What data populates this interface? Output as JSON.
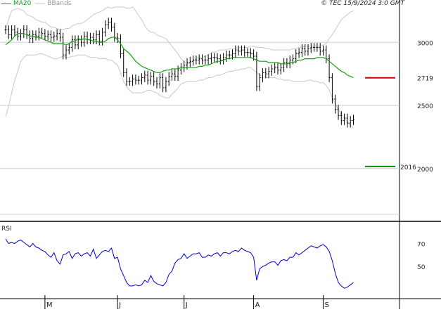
{
  "header": {
    "ma_label": "MA20",
    "bb_label": "BBands",
    "stamp": "© TEC 15/9/2024 3:0 GMT"
  },
  "colors": {
    "ma": "#10a010",
    "bands": "#c8c8c8",
    "price": "#000000",
    "rsi": "#0000c8",
    "resistance": "#cc0000",
    "support": "#009000",
    "grid": "#cccccc"
  },
  "chart_data": [
    {
      "type": "line",
      "name": "price",
      "ylim": [
        1620,
        3280
      ],
      "yticks": [
        2000,
        2500,
        3000
      ],
      "ytick_labels": [
        "2000",
        "2500",
        "3000"
      ],
      "x_month_ticks": [
        {
          "label": "M",
          "index": 13
        },
        {
          "label": "J",
          "index": 37
        },
        {
          "label": "J",
          "index": 59
        },
        {
          "label": "A",
          "index": 82
        },
        {
          "label": "S",
          "index": 105
        }
      ],
      "n": 116,
      "close": [
        3100,
        3060,
        3100,
        3080,
        3050,
        3070,
        3100,
        3060,
        3030,
        3060,
        3050,
        3080,
        3070,
        3050,
        3060,
        3040,
        3050,
        3070,
        3040,
        2900,
        2940,
        2960,
        3020,
        2980,
        3020,
        3000,
        3050,
        3020,
        3040,
        3020,
        3060,
        3010,
        3080,
        3140,
        3160,
        3120,
        3040,
        3030,
        2910,
        2760,
        2690,
        2690,
        2710,
        2700,
        2700,
        2720,
        2740,
        2700,
        2730,
        2690,
        2670,
        2720,
        2640,
        2690,
        2730,
        2750,
        2730,
        2780,
        2800,
        2820,
        2840,
        2850,
        2860,
        2860,
        2870,
        2860,
        2860,
        2870,
        2880,
        2880,
        2870,
        2860,
        2880,
        2900,
        2900,
        2910,
        2940,
        2930,
        2940,
        2920,
        2920,
        2910,
        2890,
        2650,
        2720,
        2760,
        2750,
        2770,
        2790,
        2800,
        2780,
        2800,
        2840,
        2830,
        2860,
        2870,
        2910,
        2920,
        2950,
        2930,
        2950,
        2960,
        2960,
        2960,
        2930,
        2940,
        2870,
        2720,
        2550,
        2470,
        2420,
        2380,
        2400,
        2360,
        2380,
        2390
      ],
      "ma20": [
        2980,
        3000,
        3020,
        3050,
        3070,
        3070,
        3070,
        3060,
        3050,
        3050,
        3040,
        3040,
        3030,
        3020,
        3010,
        3000,
        2990,
        2990,
        2990,
        2990,
        2980,
        2990,
        3010,
        3010,
        3030,
        3020,
        3030,
        3020,
        3020,
        3010,
        3010,
        3000,
        3000,
        3010,
        3030,
        3040,
        3040,
        3020,
        2990,
        2950,
        2930,
        2910,
        2880,
        2850,
        2830,
        2810,
        2800,
        2790,
        2780,
        2770,
        2760,
        2760,
        2770,
        2780,
        2780,
        2790,
        2790,
        2790,
        2800,
        2800,
        2800,
        2800,
        2800,
        2800,
        2810,
        2810,
        2820,
        2820,
        2830,
        2840,
        2850,
        2850,
        2860,
        2870,
        2870,
        2880,
        2880,
        2880,
        2880,
        2880,
        2880,
        2880,
        2870,
        2860,
        2850,
        2850,
        2850,
        2840,
        2840,
        2840,
        2840,
        2830,
        2830,
        2830,
        2840,
        2840,
        2850,
        2860,
        2860,
        2870,
        2870,
        2870,
        2870,
        2880,
        2880,
        2880,
        2870,
        2850,
        2830,
        2810,
        2790,
        2770,
        2760,
        2740,
        2730,
        2720
      ],
      "bb_upper": [
        3110,
        3180,
        3250,
        3260,
        3270,
        3260,
        3250,
        3220,
        3210,
        3200,
        3180,
        3170,
        3160,
        3160,
        3140,
        3120,
        3120,
        3110,
        3100,
        3100,
        3110,
        3110,
        3130,
        3140,
        3150,
        3150,
        3160,
        3180,
        3200,
        3220,
        3230,
        3240,
        3250,
        3270,
        3280,
        3270,
        3280,
        3280,
        3280,
        3280,
        3270,
        3270,
        3280,
        3250,
        3210,
        3180,
        3130,
        3100,
        3080,
        3080,
        3060,
        3050,
        3040,
        3030,
        3000,
        2970,
        2940,
        2910,
        2870,
        2850,
        2830,
        2840,
        2850,
        2870,
        2880,
        2880,
        2890,
        2900,
        2920,
        2920,
        2930,
        2940,
        2940,
        2940,
        2950,
        2950,
        2950,
        2960,
        2960,
        2960,
        2960,
        2970,
        2970,
        2960,
        2960,
        2960,
        2950,
        2950,
        2940,
        2940,
        2940,
        2940,
        2940,
        2940,
        2940,
        2950,
        2950,
        2960,
        2960,
        2970,
        2970,
        2970,
        2970,
        2970,
        2970,
        2980,
        2990,
        3030,
        3060,
        3100,
        3140,
        3180,
        3200,
        3220,
        3240,
        3250
      ],
      "bb_lower": [
        2410,
        2490,
        2600,
        2700,
        2770,
        2850,
        2880,
        2900,
        2900,
        2900,
        2900,
        2910,
        2910,
        2900,
        2890,
        2880,
        2870,
        2870,
        2880,
        2890,
        2880,
        2880,
        2890,
        2890,
        2900,
        2900,
        2900,
        2890,
        2880,
        2880,
        2880,
        2870,
        2870,
        2870,
        2860,
        2860,
        2840,
        2820,
        2760,
        2690,
        2650,
        2620,
        2600,
        2600,
        2600,
        2600,
        2610,
        2620,
        2620,
        2610,
        2600,
        2580,
        2570,
        2560,
        2560,
        2590,
        2610,
        2640,
        2670,
        2680,
        2690,
        2690,
        2690,
        2690,
        2700,
        2700,
        2710,
        2720,
        2720,
        2730,
        2740,
        2740,
        2750,
        2760,
        2770,
        2770,
        2780,
        2780,
        2790,
        2790,
        2800,
        2800,
        2780,
        2760,
        2740,
        2730,
        2720,
        2720,
        2720,
        2720,
        2710,
        2710,
        2700,
        2700,
        2700,
        2690,
        2690,
        2690,
        2690,
        2690,
        2700,
        2700,
        2690,
        2690,
        2680,
        2680,
        2660,
        2620,
        2560,
        2510,
        2470,
        2430,
        2400,
        2370,
        2340,
        2320
      ],
      "levels": [
        {
          "name": "resistance",
          "value": 2719,
          "label": "2719"
        },
        {
          "name": "support",
          "value": 2016,
          "label": "2016"
        }
      ]
    },
    {
      "type": "line",
      "name": "RSI",
      "title": "RSI",
      "ylim": [
        25,
        85
      ],
      "yticks": [
        50,
        70
      ],
      "ytick_labels": [
        "50",
        "70"
      ],
      "values": [
        74,
        70,
        71,
        70,
        72,
        73,
        71,
        69,
        67,
        70,
        67,
        66,
        64,
        63,
        60,
        58,
        62,
        55,
        52,
        60,
        61,
        63,
        57,
        61,
        62,
        59,
        61,
        62,
        59,
        65,
        57,
        60,
        63,
        64,
        63,
        66,
        57,
        58,
        48,
        42,
        36,
        33,
        33,
        34,
        33,
        34,
        38,
        36,
        42,
        37,
        35,
        34,
        33,
        36,
        43,
        46,
        53,
        56,
        57,
        61,
        57,
        59,
        61,
        61,
        62,
        58,
        58,
        60,
        59,
        61,
        62,
        59,
        62,
        62,
        61,
        63,
        64,
        63,
        66,
        64,
        63,
        62,
        58,
        38,
        48,
        50,
        51,
        53,
        54,
        54,
        51,
        55,
        56,
        55,
        58,
        58,
        62,
        60,
        62,
        64,
        66,
        68,
        67,
        66,
        68,
        69,
        67,
        63,
        55,
        44,
        36,
        33,
        31,
        32,
        34,
        36
      ]
    }
  ]
}
